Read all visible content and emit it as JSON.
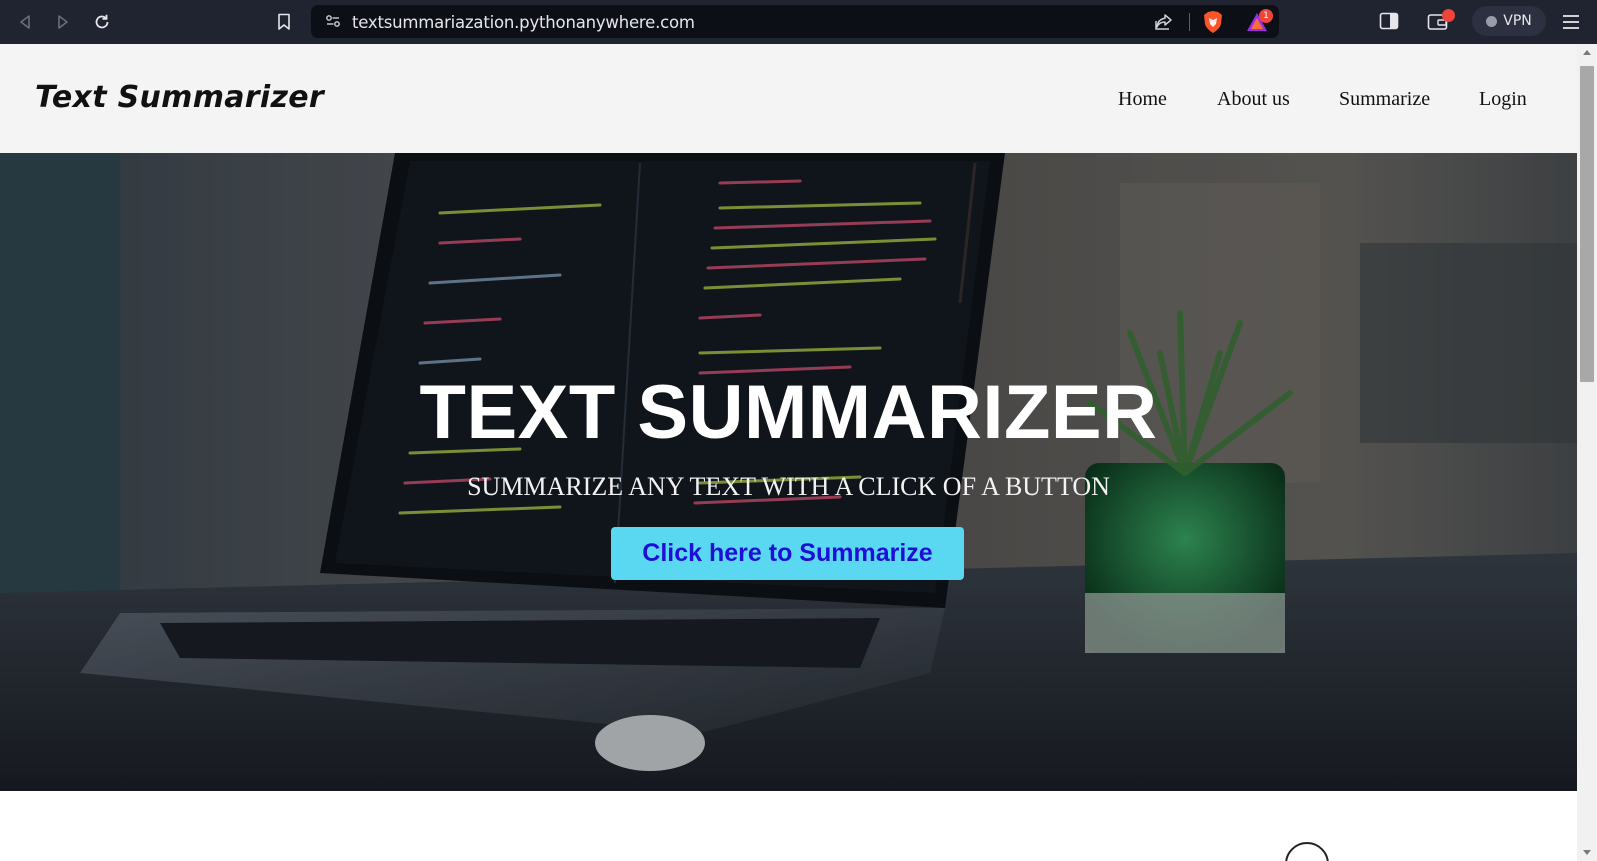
{
  "browser": {
    "url": "textsummariazation.pythonanywhere.com",
    "rewards_badge": "1",
    "vpn_label": "VPN",
    "icons": [
      "back-icon",
      "forward-icon",
      "reload-icon",
      "bookmark-icon",
      "site-info-icon",
      "share-icon",
      "brave-shields-icon",
      "brave-rewards-icon",
      "sidebar-icon",
      "wallet-icon",
      "menu-icon"
    ]
  },
  "site": {
    "brand": "Text Summarizer",
    "nav": [
      {
        "label": "Home"
      },
      {
        "label": "About us"
      },
      {
        "label": "Summarize"
      },
      {
        "label": "Login"
      }
    ]
  },
  "hero": {
    "title": "TEXT SUMMARIZER",
    "subtitle": "SUMMARIZE ANY TEXT WITH A CLICK OF A BUTTON",
    "cta_label": "Click here to Summarize"
  },
  "colors": {
    "chrome_bg": "#202330",
    "header_bg": "#f4f4f4",
    "cta_bg": "#5ad8f2",
    "cta_text": "#1d0fd6",
    "badge_red": "#f0443a"
  }
}
